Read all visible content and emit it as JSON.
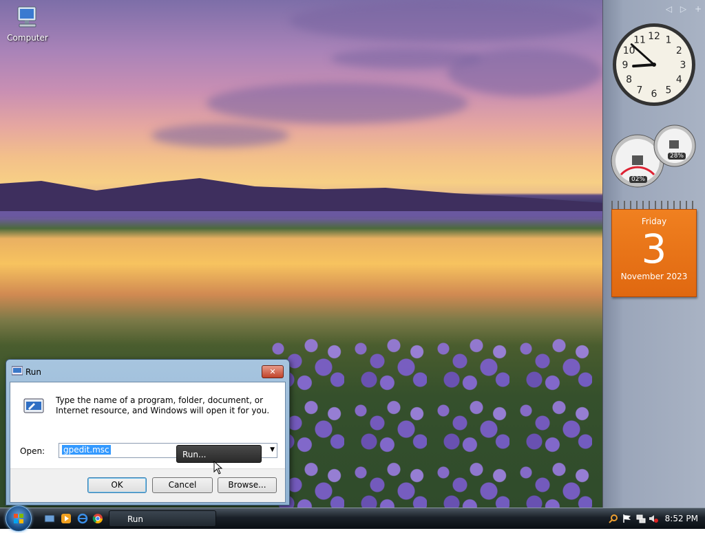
{
  "desktop": {
    "icons": [
      {
        "label": "Computer"
      }
    ]
  },
  "sidebar": {
    "clock": {
      "hour": 8,
      "minute": 52
    },
    "meters": {
      "cpu": "02%",
      "memory": "28%"
    },
    "calendar": {
      "weekday": "Friday",
      "day": "3",
      "month_year": "November 2023"
    }
  },
  "run_dialog": {
    "title": "Run",
    "close_label": "✕",
    "description": "Type the name of a program, folder, document, or Internet resource, and Windows will open it for you.",
    "open_label": "Open:",
    "open_value": "gpedit.msc",
    "ok_label": "OK",
    "cancel_label": "Cancel",
    "browse_label": "Browse..."
  },
  "tooltip": {
    "text": "Run..."
  },
  "taskbar": {
    "task_label": "Run",
    "time": "8:52 PM"
  },
  "colors": {
    "calendar_orange": "#e97a1c",
    "selection_blue": "#3399ff",
    "close_red": "#c0432a"
  }
}
